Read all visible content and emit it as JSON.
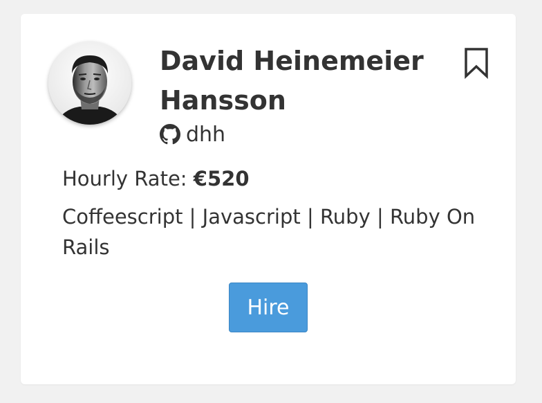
{
  "profile": {
    "name": "David Heinemeier Hansson",
    "github_username": "dhh",
    "avatar_icon": "person-photo-icon",
    "bookmark_icon": "bookmark-icon",
    "github_icon": "github-icon"
  },
  "rate": {
    "label": "Hourly Rate: ",
    "value": "€520"
  },
  "skills": "Coffeescript | Javascript | Ruby | Ruby On Rails",
  "actions": {
    "hire_label": "Hire"
  },
  "colors": {
    "hire_button": "#4a9bdc",
    "text": "#333333",
    "background": "#f1f1f1",
    "card": "#ffffff"
  }
}
